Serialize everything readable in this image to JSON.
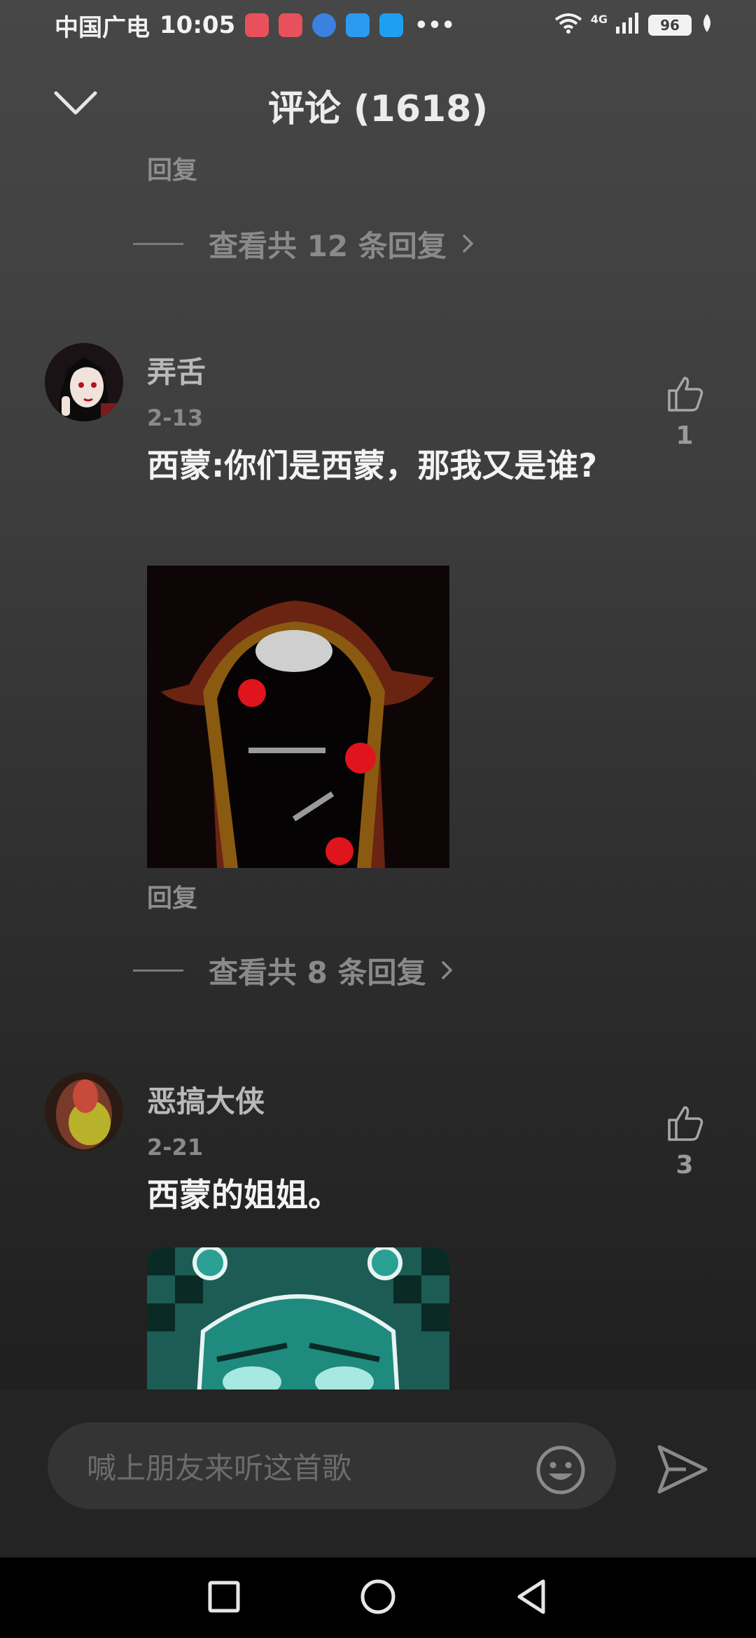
{
  "status_bar": {
    "carrier": "中国广电",
    "time": "10:05",
    "network": "4G",
    "battery": "96"
  },
  "header": {
    "title": "评论 (1618)"
  },
  "prev_thread": {
    "reply_label": "回复",
    "view_replies": "查看共 12 条回复"
  },
  "comments": [
    {
      "username": "弄舌",
      "date": "2-13",
      "text": "西蒙:你们是西蒙，那我又是谁?",
      "likes": "1",
      "reply_label": "回复",
      "view_replies": "查看共 8 条回复"
    },
    {
      "username": "恶搞大侠",
      "date": "2-21",
      "text": "西蒙的姐姐。",
      "likes": "3"
    }
  ],
  "input": {
    "placeholder": "喊上朋友来听这首歌"
  },
  "colors": {
    "background_top": "#474747",
    "background_bottom": "#1b1b1b",
    "input_bar": "#242424",
    "nav_bar": "#000000"
  }
}
